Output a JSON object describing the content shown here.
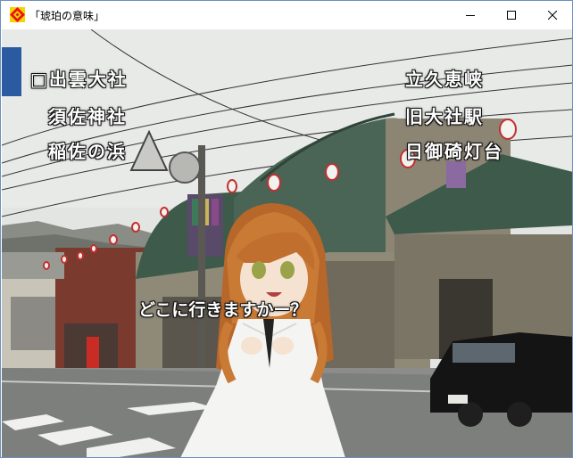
{
  "window": {
    "title": "「琥珀の意味」",
    "icon": "diamond-app-icon",
    "controls": [
      "minimize-icon",
      "maximize-icon",
      "close-icon"
    ]
  },
  "menu": {
    "left": [
      "□出雲大社",
      "須佐神社",
      "稲佐の浜"
    ],
    "right": [
      "立久恵峡",
      "旧大社駅",
      "日御碕灯台"
    ]
  },
  "dialogue": {
    "text": "どこに行きますかー？"
  },
  "colors": {
    "title_icon_red": "#e8141b",
    "title_icon_yellow": "#f5d400",
    "menu_text": "#ffffff",
    "roof_green": "#3d5a4a"
  }
}
